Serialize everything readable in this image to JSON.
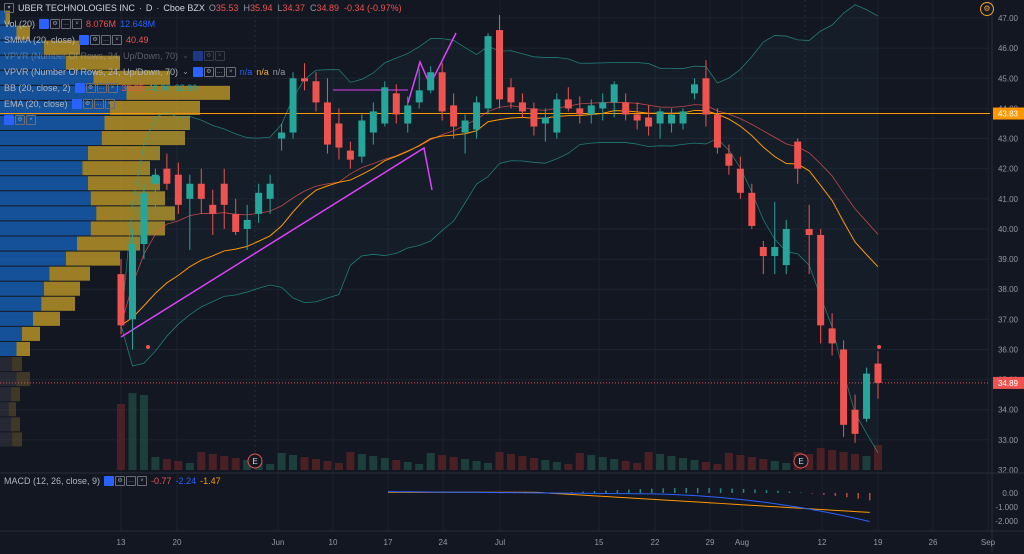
{
  "symbol": {
    "name": "UBER TECHNOLOGIES INC",
    "sep": "·",
    "interval": "D",
    "exchange": "Cboe BZX",
    "ohlc": {
      "o_label": "O",
      "o": "35.53",
      "h_label": "H",
      "h": "35.94",
      "l_label": "L",
      "l": "34.37",
      "c_label": "C",
      "c": "34.89",
      "chg": "-0.34 (-0.97%)"
    }
  },
  "indicators": {
    "vol": {
      "title": "Vol (20)",
      "v1": "8.076M",
      "v2": "12.648M"
    },
    "smma": {
      "title": "SMMA (20, close)",
      "v1": "40.49"
    },
    "vpvr1": {
      "title": "VPVR (Number Of Rows, 24, Up/Down, 70)"
    },
    "vpvr2": {
      "title": "VPVR (Number Of Rows, 24, Up/Down, 70)",
      "v1": "n/a",
      "v2": "n/a",
      "v3": "n/a"
    },
    "bb": {
      "title": "BB (20, close, 2)",
      "v1": "39.85",
      "v2": "46.90",
      "v3": "32.80"
    },
    "ema": {
      "title": "EMA (20, close)"
    },
    "macd": {
      "title": "MACD (12, 26, close, 9)",
      "v1": "-0.77",
      "v2": "-2.24",
      "v3": "-1.47"
    }
  },
  "price_axis": {
    "labels": [
      "47.00",
      "46.00",
      "45.00",
      "44.00",
      "43.00",
      "42.00",
      "41.00",
      "40.00",
      "39.00",
      "38.00",
      "37.00",
      "36.00",
      "35.00",
      "34.00",
      "33.00",
      "32.00"
    ],
    "current_price": "34.89",
    "line_price": "43.83"
  },
  "macd_axis": {
    "labels": [
      "0.00",
      "-1.000",
      "-2.000"
    ]
  },
  "time_axis": {
    "labels": [
      "13",
      "20",
      "Jun",
      "10",
      "17",
      "24",
      "Jul",
      "15",
      "22",
      "29",
      "Aug",
      "12",
      "19",
      "26",
      "Sep"
    ]
  },
  "earnings_marker": "E",
  "colors": {
    "up": "#26a69a",
    "down": "#ef5350",
    "bb": "#26a69a",
    "smma": "#ef5350",
    "ema": "#ff9800",
    "pattern": "#e040fb",
    "price_line": "#ff9800",
    "current": "#ef5350"
  },
  "chart_data": {
    "type": "candlestick",
    "price_range": [
      32,
      47.2
    ],
    "candles": [
      {
        "o": 38.5,
        "h": 39.0,
        "l": 36.5,
        "c": 36.8
      },
      {
        "o": 37.0,
        "h": 40.0,
        "l": 36.0,
        "c": 39.5
      },
      {
        "o": 39.5,
        "h": 41.5,
        "l": 39.0,
        "c": 41.2
      },
      {
        "o": 41.5,
        "h": 42.0,
        "l": 40.5,
        "c": 41.8
      },
      {
        "o": 42.0,
        "h": 42.5,
        "l": 41.3,
        "c": 41.5
      },
      {
        "o": 41.8,
        "h": 42.2,
        "l": 40.5,
        "c": 40.8
      },
      {
        "o": 41.0,
        "h": 41.8,
        "l": 39.3,
        "c": 41.5
      },
      {
        "o": 41.5,
        "h": 42.0,
        "l": 40.5,
        "c": 41.0
      },
      {
        "o": 40.8,
        "h": 41.3,
        "l": 39.8,
        "c": 40.5
      },
      {
        "o": 41.5,
        "h": 42.0,
        "l": 40.0,
        "c": 40.8
      },
      {
        "o": 40.5,
        "h": 41.0,
        "l": 39.8,
        "c": 39.9
      },
      {
        "o": 40.0,
        "h": 40.8,
        "l": 39.3,
        "c": 40.3
      },
      {
        "o": 40.5,
        "h": 41.5,
        "l": 40.2,
        "c": 41.2
      },
      {
        "o": 41.0,
        "h": 41.8,
        "l": 40.5,
        "c": 41.5
      },
      {
        "o": 43.0,
        "h": 43.5,
        "l": 42.6,
        "c": 43.2
      },
      {
        "o": 43.2,
        "h": 45.2,
        "l": 43.0,
        "c": 45.0
      },
      {
        "o": 45.0,
        "h": 45.5,
        "l": 44.6,
        "c": 44.9
      },
      {
        "o": 44.9,
        "h": 45.2,
        "l": 43.9,
        "c": 44.2
      },
      {
        "o": 44.2,
        "h": 45.0,
        "l": 42.5,
        "c": 42.8
      },
      {
        "o": 43.5,
        "h": 44.0,
        "l": 42.3,
        "c": 42.7
      },
      {
        "o": 42.6,
        "h": 42.9,
        "l": 42.0,
        "c": 42.3
      },
      {
        "o": 42.4,
        "h": 43.8,
        "l": 42.2,
        "c": 43.6
      },
      {
        "o": 43.2,
        "h": 44.2,
        "l": 42.8,
        "c": 43.9
      },
      {
        "o": 43.5,
        "h": 44.9,
        "l": 43.4,
        "c": 44.7
      },
      {
        "o": 44.5,
        "h": 44.8,
        "l": 43.5,
        "c": 43.8
      },
      {
        "o": 43.5,
        "h": 44.4,
        "l": 43.2,
        "c": 44.1
      },
      {
        "o": 44.2,
        "h": 45.3,
        "l": 44.0,
        "c": 44.6
      },
      {
        "o": 44.6,
        "h": 45.4,
        "l": 44.5,
        "c": 45.2
      },
      {
        "o": 45.2,
        "h": 45.5,
        "l": 43.6,
        "c": 43.9
      },
      {
        "o": 44.1,
        "h": 44.5,
        "l": 43.0,
        "c": 43.4
      },
      {
        "o": 43.2,
        "h": 43.8,
        "l": 42.5,
        "c": 43.6
      },
      {
        "o": 43.3,
        "h": 44.4,
        "l": 43.0,
        "c": 44.2
      },
      {
        "o": 44.0,
        "h": 46.5,
        "l": 43.8,
        "c": 46.4
      },
      {
        "o": 46.6,
        "h": 47.1,
        "l": 44.0,
        "c": 44.3
      },
      {
        "o": 44.7,
        "h": 45.0,
        "l": 44.0,
        "c": 44.2
      },
      {
        "o": 44.2,
        "h": 44.5,
        "l": 43.7,
        "c": 43.9
      },
      {
        "o": 44.0,
        "h": 44.2,
        "l": 43.1,
        "c": 43.4
      },
      {
        "o": 43.5,
        "h": 44.0,
        "l": 42.9,
        "c": 43.7
      },
      {
        "o": 43.2,
        "h": 44.5,
        "l": 43.0,
        "c": 44.3
      },
      {
        "o": 44.3,
        "h": 44.7,
        "l": 43.9,
        "c": 44.0
      },
      {
        "o": 44.0,
        "h": 44.4,
        "l": 43.5,
        "c": 43.8
      },
      {
        "o": 43.8,
        "h": 44.3,
        "l": 43.5,
        "c": 44.1
      },
      {
        "o": 44.0,
        "h": 44.5,
        "l": 43.6,
        "c": 44.2
      },
      {
        "o": 44.2,
        "h": 44.9,
        "l": 43.7,
        "c": 44.8
      },
      {
        "o": 44.2,
        "h": 44.5,
        "l": 43.6,
        "c": 43.8
      },
      {
        "o": 43.8,
        "h": 44.2,
        "l": 43.3,
        "c": 43.6
      },
      {
        "o": 43.7,
        "h": 44.1,
        "l": 43.1,
        "c": 43.4
      },
      {
        "o": 43.5,
        "h": 44.0,
        "l": 43.0,
        "c": 43.9
      },
      {
        "o": 43.5,
        "h": 44.0,
        "l": 43.2,
        "c": 43.8
      },
      {
        "o": 43.5,
        "h": 44.0,
        "l": 43.3,
        "c": 43.9
      },
      {
        "o": 44.5,
        "h": 45.0,
        "l": 44.3,
        "c": 44.8
      },
      {
        "o": 45.0,
        "h": 45.6,
        "l": 43.4,
        "c": 43.8
      },
      {
        "o": 43.8,
        "h": 44.0,
        "l": 42.5,
        "c": 42.7
      },
      {
        "o": 42.5,
        "h": 42.8,
        "l": 41.8,
        "c": 42.1
      },
      {
        "o": 42.0,
        "h": 42.4,
        "l": 41.0,
        "c": 41.2
      },
      {
        "o": 41.2,
        "h": 41.5,
        "l": 40.0,
        "c": 40.1
      },
      {
        "o": 39.4,
        "h": 39.6,
        "l": 38.5,
        "c": 39.1
      },
      {
        "o": 39.1,
        "h": 40.9,
        "l": 38.5,
        "c": 39.4
      },
      {
        "o": 38.8,
        "h": 40.3,
        "l": 38.5,
        "c": 40.0
      },
      {
        "o": 42.9,
        "h": 43.0,
        "l": 41.5,
        "c": 42.0
      },
      {
        "o": 40.0,
        "h": 40.8,
        "l": 38.5,
        "c": 39.8
      },
      {
        "o": 39.8,
        "h": 40.0,
        "l": 36.2,
        "c": 36.8
      },
      {
        "o": 36.7,
        "h": 37.2,
        "l": 35.8,
        "c": 36.2
      },
      {
        "o": 36.0,
        "h": 36.3,
        "l": 33.1,
        "c": 33.5
      },
      {
        "o": 34.0,
        "h": 34.5,
        "l": 32.9,
        "c": 33.2
      },
      {
        "o": 33.7,
        "h": 35.4,
        "l": 33.6,
        "c": 35.2
      },
      {
        "o": 35.53,
        "h": 35.94,
        "l": 34.37,
        "c": 34.89
      }
    ]
  }
}
